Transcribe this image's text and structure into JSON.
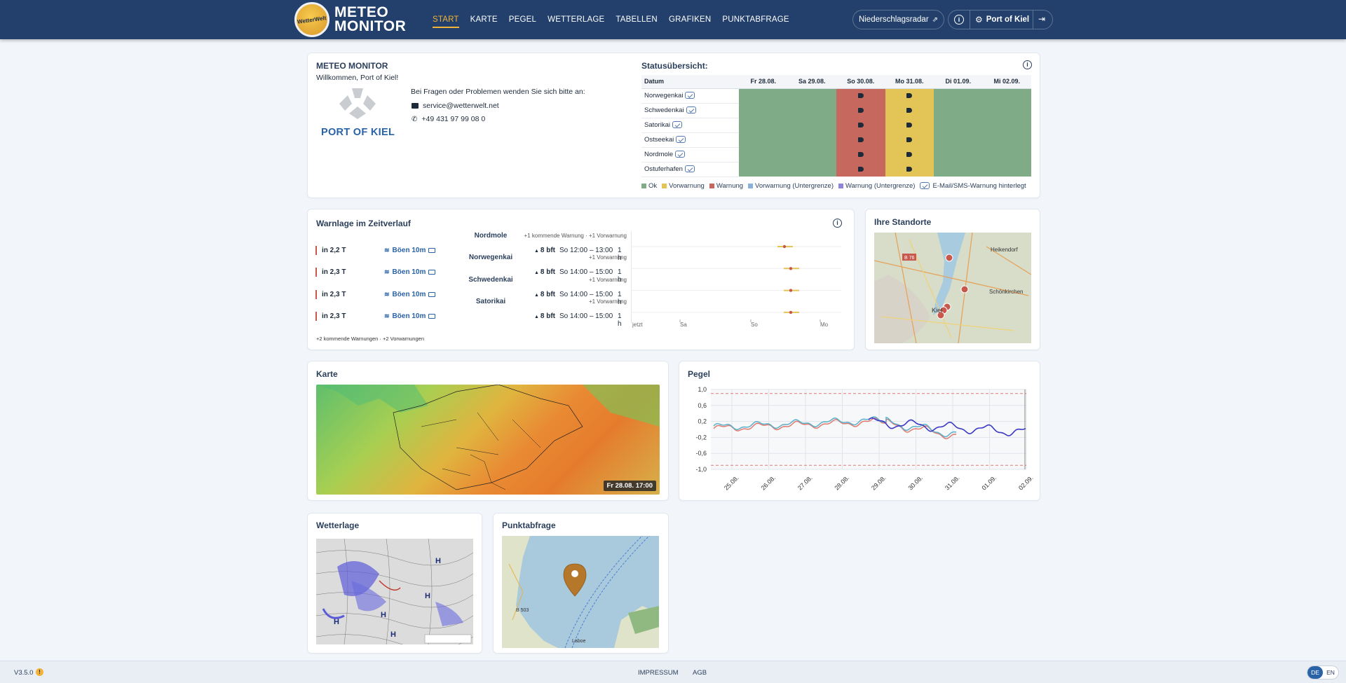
{
  "header": {
    "logo_text": "WetterWelt",
    "brand_line1": "METEO",
    "brand_line2": "MONITOR",
    "nav": [
      {
        "label": "START",
        "active": true
      },
      {
        "label": "KARTE"
      },
      {
        "label": "PEGEL"
      },
      {
        "label": "WETTERLAGE"
      },
      {
        "label": "TABELLEN"
      },
      {
        "label": "GRAFIKEN"
      },
      {
        "label": "PUNKTABFRAGE"
      }
    ],
    "radar_label": "Niederschlagsradar",
    "user_label": "Port of Kiel"
  },
  "welcome": {
    "title": "METEO MONITOR",
    "greeting": "Willkommen, Port of Kiel!",
    "port_name": "PORT OF KIEL",
    "contact_intro": "Bei Fragen oder Problemen wenden Sie sich bitte an:",
    "email": "service@wetterwelt.net",
    "phone": "+49 431 97 99 08 0"
  },
  "status": {
    "title": "Statusübersicht:",
    "date_header": "Datum",
    "dates": [
      "Fr 28.08.",
      "Sa 29.08.",
      "So 30.08.",
      "Mo 31.08.",
      "Di 01.09.",
      "Mi 02.09."
    ],
    "locations": [
      "Norwegenkai",
      "Schwedenkai",
      "Satorikai",
      "Ostseekai",
      "Nordmole",
      "Ostuferhafen"
    ],
    "day_status": [
      "ok",
      "ok",
      "warnung",
      "vorwarnung",
      "ok",
      "ok"
    ],
    "colors": {
      "ok": "#7fab86",
      "vorwarnung": "#e3c456",
      "warnung": "#c6685e"
    },
    "legend": [
      "Ok",
      "Vorwarnung",
      "Warnung",
      "Vorwarnung (Untergrenze)",
      "Warnung (Untergrenze)",
      "E-Mail/SMS-Warnung hinterlegt"
    ],
    "legend_colors": [
      "#7fab86",
      "#e3c456",
      "#c6685e",
      "#8ab2d9",
      "#8e84d9"
    ]
  },
  "warnlage": {
    "title": "Warnlage im Zeitverlauf",
    "rows": [
      {
        "location": "Nordmole",
        "note": "+1 kommende Warnung · +1 Vorwarnung",
        "when": "in 2,2 T",
        "param": "Böen 10m",
        "value": "8 bft",
        "time": "So 12:00 – 13:00",
        "dur": "1 h"
      },
      {
        "location": "Norwegenkai",
        "note": "+1 Vorwarnung",
        "when": "in 2,3 T",
        "param": "Böen 10m",
        "value": "8 bft",
        "time": "So 14:00 – 15:00",
        "dur": "1 h"
      },
      {
        "location": "Schwedenkai",
        "note": "+1 Vorwarnung",
        "when": "in 2,3 T",
        "param": "Böen 10m",
        "value": "8 bft",
        "time": "So 14:00 – 15:00",
        "dur": "1 h"
      },
      {
        "location": "Satorikai",
        "note": "+1 Vorwarnung",
        "when": "in 2,3 T",
        "param": "Böen 10m",
        "value": "8 bft",
        "time": "So 14:00 – 15:00",
        "dur": "1 h"
      }
    ],
    "axis": [
      "jetzt",
      "Sa",
      "So",
      "Mo"
    ],
    "footer": "+2 kommende Warnungen · +2 Vorwarnungen"
  },
  "standorte": {
    "title": "Ihre Standorte",
    "labels": [
      "Heikendorf",
      "Schönkirchen",
      "Kiel",
      "B 76"
    ]
  },
  "karte": {
    "title": "Karte",
    "timestamp": "Fr 28.08. 17:00"
  },
  "pegel": {
    "title": "Pegel",
    "chart_data": {
      "type": "line",
      "ylim": [
        -1.0,
        1.0
      ],
      "yticks": [
        "1,0",
        "0,6",
        "0,2",
        "-0,2",
        "-0,6",
        "-1,0"
      ],
      "xticks": [
        "25.08.",
        "26.08.",
        "27.08.",
        "28.08.",
        "29.08.",
        "30.08.",
        "31.08.",
        "01.09.",
        "02.09."
      ],
      "threshold_lines": [
        0.9,
        -0.9
      ],
      "series": [
        {
          "color": "#e17b70"
        },
        {
          "color": "#5bb0c9"
        },
        {
          "color": "#3b38c4"
        }
      ]
    }
  },
  "wetterlage": {
    "title": "Wetterlage",
    "pressure_labels": [
      "H",
      "H",
      "H",
      "H",
      "H"
    ]
  },
  "punkt": {
    "title": "Punktabfrage",
    "labels": [
      "B 503",
      "Laboe"
    ]
  },
  "footer": {
    "version": "V3.5.0",
    "links": [
      "IMPRESSUM",
      "AGB"
    ],
    "langs": [
      "DE",
      "EN"
    ]
  }
}
